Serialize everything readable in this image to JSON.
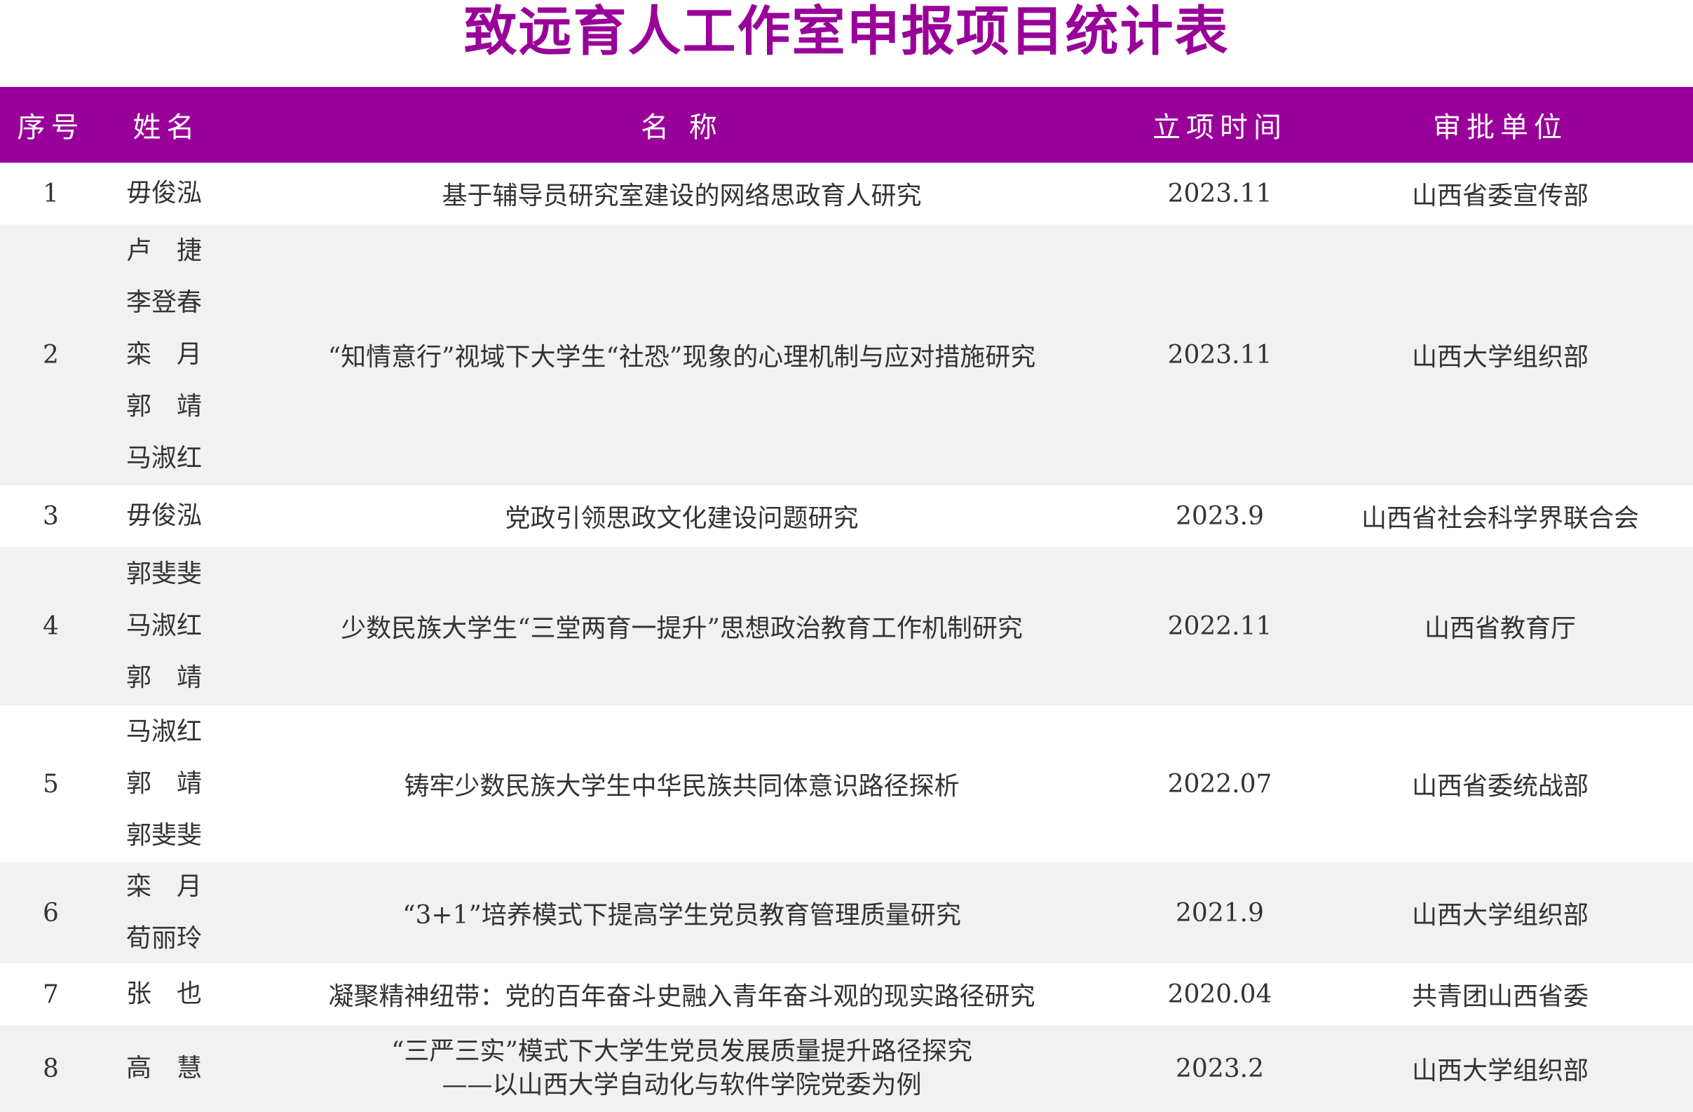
{
  "title": "致远育人工作室申报项目统计表",
  "colors": {
    "header_bg": "#990099",
    "title_color": "#990099",
    "alt_row_bg": "#f1f1f1"
  },
  "headers": {
    "no": "序号",
    "name": "姓名",
    "title": "名 称",
    "date": "立项时间",
    "unit": "审批单位"
  },
  "rows": [
    {
      "no": "1",
      "names": [
        "毋俊泓"
      ],
      "title": [
        "基于辅导员研究室建设的网络思政育人研究"
      ],
      "date": "2023.11",
      "unit": "山西省委宣传部"
    },
    {
      "no": "2",
      "names": [
        "卢　捷",
        "李登春",
        "栾　月",
        "郭　靖",
        "马淑红"
      ],
      "title": [
        "“知情意行”视域下大学生“社恐”现象的心理机制与应对措施研究"
      ],
      "date": "2023.11",
      "unit": "山西大学组织部"
    },
    {
      "no": "3",
      "names": [
        "毋俊泓"
      ],
      "title": [
        "党政引领思政文化建设问题研究"
      ],
      "date": "2023.9",
      "unit": "山西省社会科学界联合会"
    },
    {
      "no": "4",
      "names": [
        "郭斐斐",
        "马淑红",
        "郭　靖"
      ],
      "title": [
        "少数民族大学生“三堂两育一提升”思想政治教育工作机制研究"
      ],
      "date": "2022.11",
      "unit": "山西省教育厅"
    },
    {
      "no": "5",
      "names": [
        "马淑红",
        "郭　靖",
        "郭斐斐"
      ],
      "title": [
        "铸牢少数民族大学生中华民族共同体意识路径探析"
      ],
      "date": "2022.07",
      "unit": "山西省委统战部"
    },
    {
      "no": "6",
      "names": [
        "栾　月",
        "荀丽玲"
      ],
      "title": [
        "“3+1”培养模式下提高学生党员教育管理质量研究"
      ],
      "date": "2021.9",
      "unit": "山西大学组织部"
    },
    {
      "no": "7",
      "names": [
        "张　也"
      ],
      "title": [
        "凝聚精神纽带：党的百年奋斗史融入青年奋斗观的现实路径研究"
      ],
      "date": "2020.04",
      "unit": "共青团山西省委"
    },
    {
      "no": "8",
      "names": [
        "高　慧"
      ],
      "title": [
        "“三严三实”模式下大学生党员发展质量提升路径探究",
        "——以山西大学自动化与软件学院党委为例"
      ],
      "date": "2023.2",
      "unit": "山西大学组织部"
    }
  ]
}
